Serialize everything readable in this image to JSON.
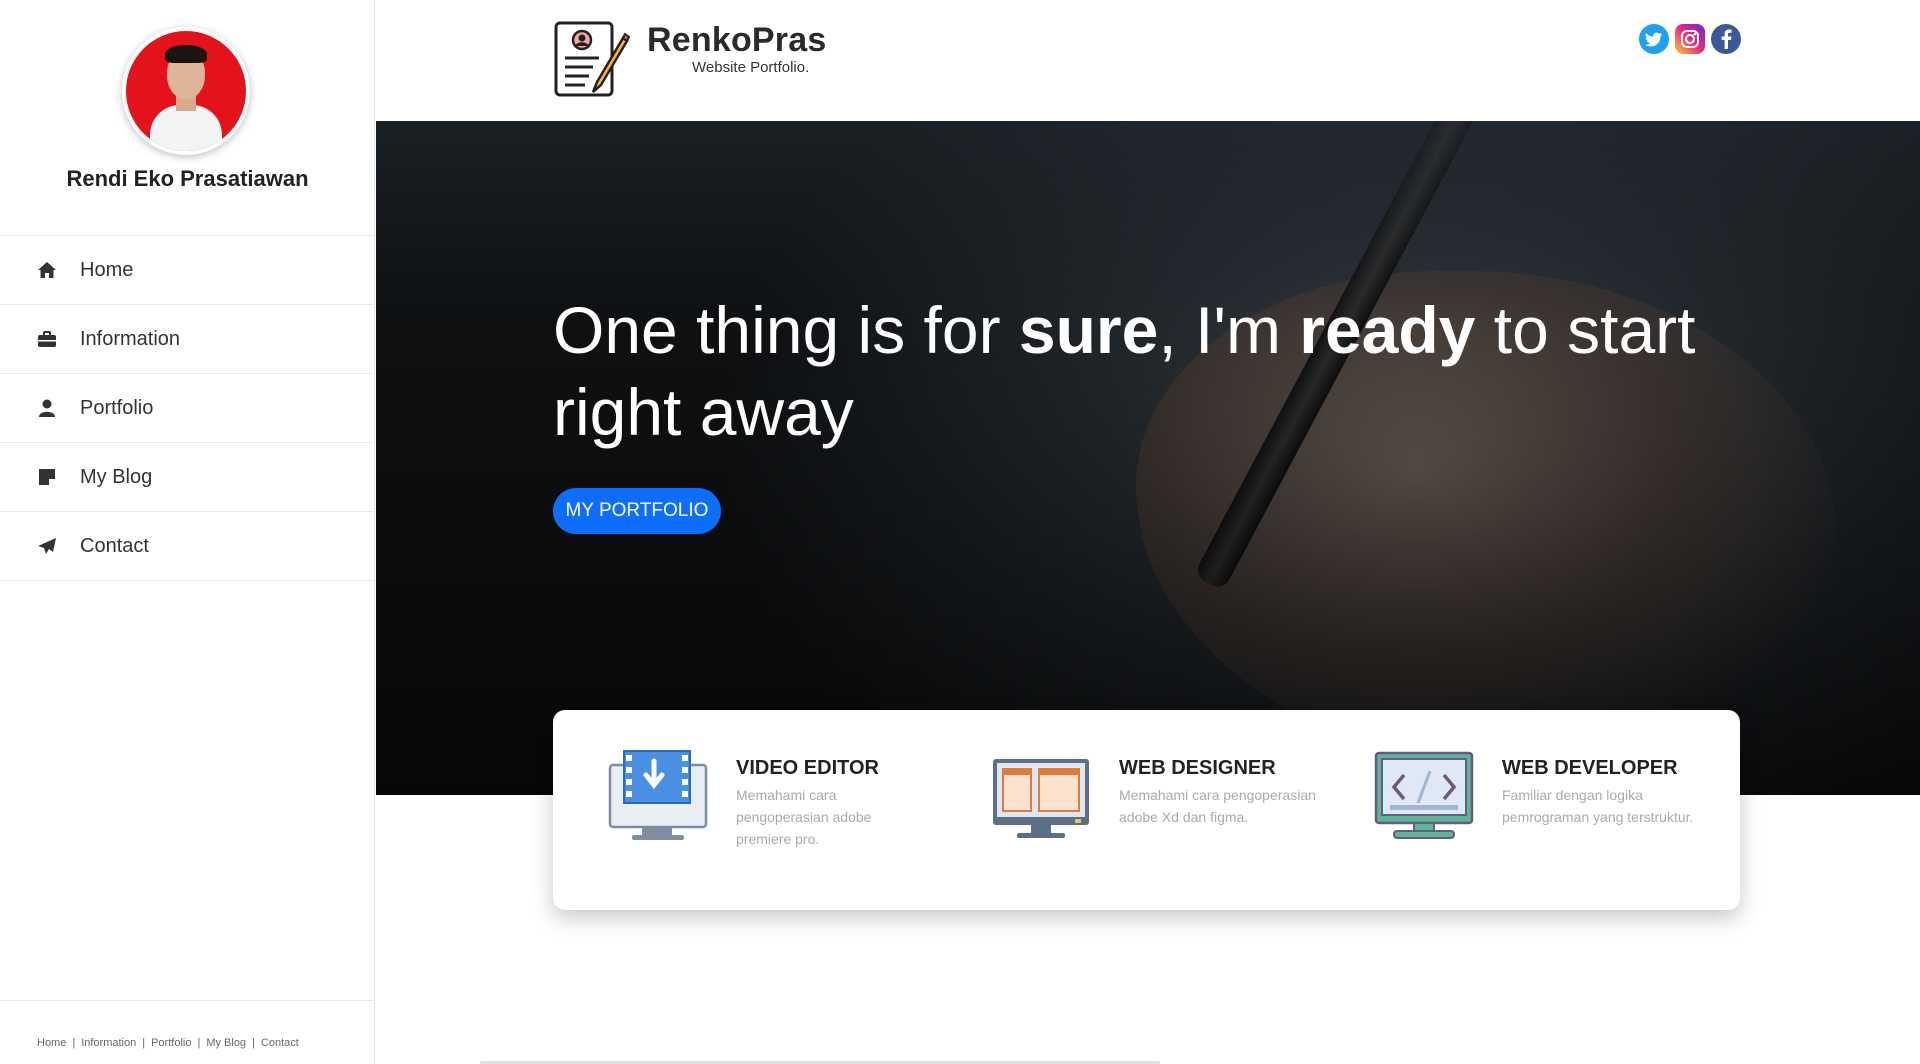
{
  "sidebar": {
    "name": "Rendi Eko Prasatiawan",
    "items": [
      {
        "label": "Home",
        "icon": "home-icon"
      },
      {
        "label": "Information",
        "icon": "briefcase-icon"
      },
      {
        "label": "Portfolio",
        "icon": "user-icon"
      },
      {
        "label": "My Blog",
        "icon": "note-icon"
      },
      {
        "label": "Contact",
        "icon": "paper-plane-icon"
      }
    ],
    "footer_links": [
      "Home",
      "Information",
      "Portfolio",
      "My Blog",
      "Contact"
    ],
    "footer_separator": "|"
  },
  "header": {
    "brand": "RenkoPras",
    "subtitle": "Website Portfolio.",
    "socials": [
      {
        "name": "twitter-icon",
        "color": "#1da1f2"
      },
      {
        "name": "instagram-icon",
        "color": "#d6249f"
      },
      {
        "name": "facebook-icon",
        "color": "#3b5998"
      }
    ]
  },
  "hero": {
    "title_part1": "One thing is for ",
    "title_bold1": "sure",
    "title_part2": ", I'm ",
    "title_bold2": "ready",
    "title_part3": " to start right away",
    "button_label": "MY PORTFOLIO",
    "button_color": "#0d6efd"
  },
  "services": [
    {
      "title": "VIDEO EDITOR",
      "desc": "Memahami cara pengoperasian adobe premiere pro.",
      "icon": "video-editor-icon"
    },
    {
      "title": "WEB DESIGNER",
      "desc": "Memahami cara pengoperasian adobe Xd dan figma.",
      "icon": "web-designer-icon"
    },
    {
      "title": "WEB DEVELOPER",
      "desc": "Familiar dengan logika pemrograman yang terstruktur.",
      "icon": "web-developer-icon"
    }
  ]
}
